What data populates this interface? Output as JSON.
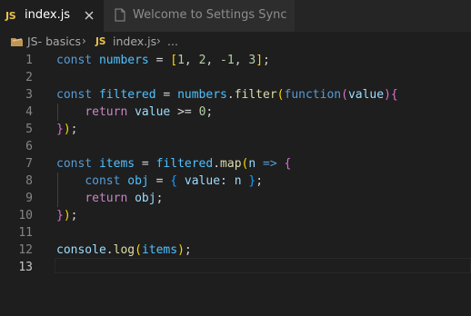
{
  "tabs": [
    {
      "badge": "JS",
      "label": "index.js",
      "active": true
    },
    {
      "label": "Welcome to Settings Sync",
      "active": false
    }
  ],
  "breadcrumb": {
    "folder": "JS- basics",
    "separator": "›",
    "file_badge": "JS",
    "file": "index.js",
    "more": "..."
  },
  "editor": {
    "current_line": 13,
    "lines": [
      {
        "n": "1"
      },
      {
        "n": "2"
      },
      {
        "n": "3"
      },
      {
        "n": "4"
      },
      {
        "n": "5"
      },
      {
        "n": "6"
      },
      {
        "n": "7"
      },
      {
        "n": "8"
      },
      {
        "n": "9"
      },
      {
        "n": "10"
      },
      {
        "n": "11"
      },
      {
        "n": "12"
      },
      {
        "n": "13"
      }
    ],
    "tokens": {
      "l1": [
        "const",
        " ",
        "numbers",
        " = ",
        "[",
        "1",
        ", ",
        "2",
        ", ",
        "-1",
        ", ",
        "3",
        "]",
        ";"
      ],
      "l3": [
        "const",
        " ",
        "filtered",
        " = ",
        "numbers",
        ".",
        "filter",
        "(",
        "function",
        "(",
        "value",
        ")",
        "{"
      ],
      "l4": [
        "    ",
        "return",
        " ",
        "value",
        " >= ",
        "0",
        ";"
      ],
      "l5": [
        "}",
        ")",
        ";"
      ],
      "l7": [
        "const",
        " ",
        "items",
        " = ",
        "filtered",
        ".",
        "map",
        "(",
        "n",
        " => ",
        "{"
      ],
      "l8": [
        "    ",
        "const",
        " ",
        "obj",
        " = ",
        "{",
        " value: ",
        "n",
        " ",
        "}",
        ";"
      ],
      "l9": [
        "    ",
        "return",
        " ",
        "obj",
        ";"
      ],
      "l10": [
        "}",
        ")",
        ";"
      ],
      "l12": [
        "console",
        ".",
        "log",
        "(",
        "items",
        ")",
        ";"
      ]
    }
  },
  "colors": {
    "background": "#1e1e1e",
    "tabbar": "#252526",
    "js_badge": "#e8c24b",
    "keyword": "#569cd6",
    "control": "#c586c0",
    "variable": "#4fc1ff",
    "function": "#dcdcaa",
    "parameter": "#9cdcfe",
    "number": "#b5cea8"
  },
  "icons": {
    "close": "close-icon",
    "file": "file-icon",
    "folder": "folder-icon"
  }
}
